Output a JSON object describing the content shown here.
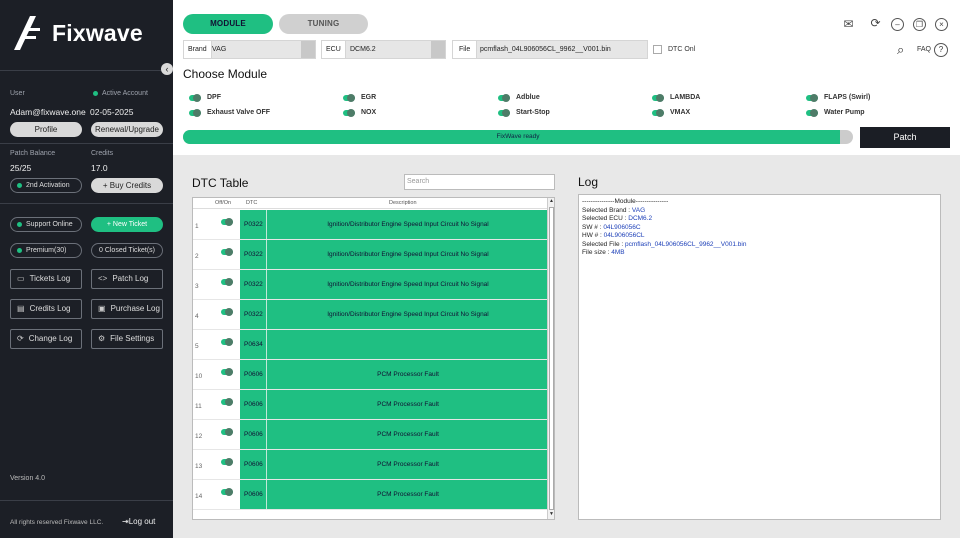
{
  "app": {
    "name": "Fixwave"
  },
  "sidebar": {
    "user_label": "User",
    "account_status": "Active Account",
    "email": "Adam@fixwave.one",
    "date": "02-05-2025",
    "profile_btn": "Profile",
    "renew_btn": "Renewal/Upgrade",
    "patch_balance_label": "Patch Balance",
    "patch_balance": "25/25",
    "credits_label": "Credits",
    "credits": "17.0",
    "second_activation": "2nd Activation",
    "buy_credits": "+ Buy Credits",
    "support": "Support Online",
    "new_ticket": "+ New Ticket",
    "premium": "Premium(30)",
    "closed_tickets": "0 Closed Ticket(s)",
    "logs": {
      "tickets": "Tickets Log",
      "patch": "Patch Log",
      "credits": "Credits Log",
      "purchase": "Purchase Log",
      "change": "Change Log",
      "file_settings": "File Settings"
    },
    "version": "Version 4.0",
    "rights": "All rights reserved Fixwave LLC.",
    "logout": "Log out"
  },
  "header": {
    "tab_module": "MODULE",
    "tab_tuning": "TUNING",
    "brand_label": "Brand",
    "brand_value": "VAG",
    "ecu_label": "ECU",
    "ecu_value": "DCM6.2",
    "file_label": "File",
    "file_value": "pcmflash_04L906056CL_9962__V001.bin",
    "dtc_only": "DTC Onl",
    "faq": "FAQ",
    "help": "?"
  },
  "modules": {
    "title": "Choose Module",
    "items": [
      {
        "label": "DPF"
      },
      {
        "label": "EGR"
      },
      {
        "label": "Adblue"
      },
      {
        "label": "LAMBDA"
      },
      {
        "label": "FLAPS (Swirl)"
      },
      {
        "label": "Exhaust Valve OFF"
      },
      {
        "label": "NOX"
      },
      {
        "label": "Start-Stop"
      },
      {
        "label": "VMAX"
      },
      {
        "label": "Water Pump"
      }
    ]
  },
  "progress": {
    "text": "FixWave ready",
    "fraction": 0.98
  },
  "patch_btn": "Patch",
  "dtc": {
    "title": "DTC Table",
    "search_placeholder": "Search",
    "col_offon": "Off/On",
    "col_dtc": "DTC",
    "col_desc": "Description",
    "rows": [
      {
        "num": "1",
        "code": "P0322",
        "desc": "Ignition/Distributor Engine Speed Input Circuit No Signal"
      },
      {
        "num": "2",
        "code": "P0322",
        "desc": "Ignition/Distributor Engine Speed Input Circuit No Signal"
      },
      {
        "num": "3",
        "code": "P0322",
        "desc": "Ignition/Distributor Engine Speed Input Circuit No Signal"
      },
      {
        "num": "4",
        "code": "P0322",
        "desc": "Ignition/Distributor Engine Speed Input Circuit No Signal"
      },
      {
        "num": "5",
        "code": "P0634",
        "desc": ""
      },
      {
        "num": "10",
        "code": "P0606",
        "desc": "PCM Processor Fault"
      },
      {
        "num": "11",
        "code": "P0606",
        "desc": "PCM Processor Fault"
      },
      {
        "num": "12",
        "code": "P0606",
        "desc": "PCM Processor Fault"
      },
      {
        "num": "13",
        "code": "P0606",
        "desc": "PCM Processor Fault"
      },
      {
        "num": "14",
        "code": "P0606",
        "desc": "PCM Processor Fault"
      }
    ]
  },
  "log": {
    "title": "Log",
    "header_line": "---------------Module---------------",
    "lines": [
      {
        "k": "Selected Brand : ",
        "v": "VAG"
      },
      {
        "k": "Selected ECU : ",
        "v": "DCM6.2"
      },
      {
        "k": "SW # : ",
        "v": "04L906056C"
      },
      {
        "k": "HW # : ",
        "v": "04L906056CL"
      },
      {
        "k": "Selected File : ",
        "v": "pcmflash_04L906056CL_9962__V001.bin"
      },
      {
        "k": "File size : ",
        "v": "4MB"
      }
    ]
  },
  "colors": {
    "accent": "#1fbf82",
    "sidebar": "#1c1f26",
    "tab_inactive": "#d0d0d0"
  }
}
